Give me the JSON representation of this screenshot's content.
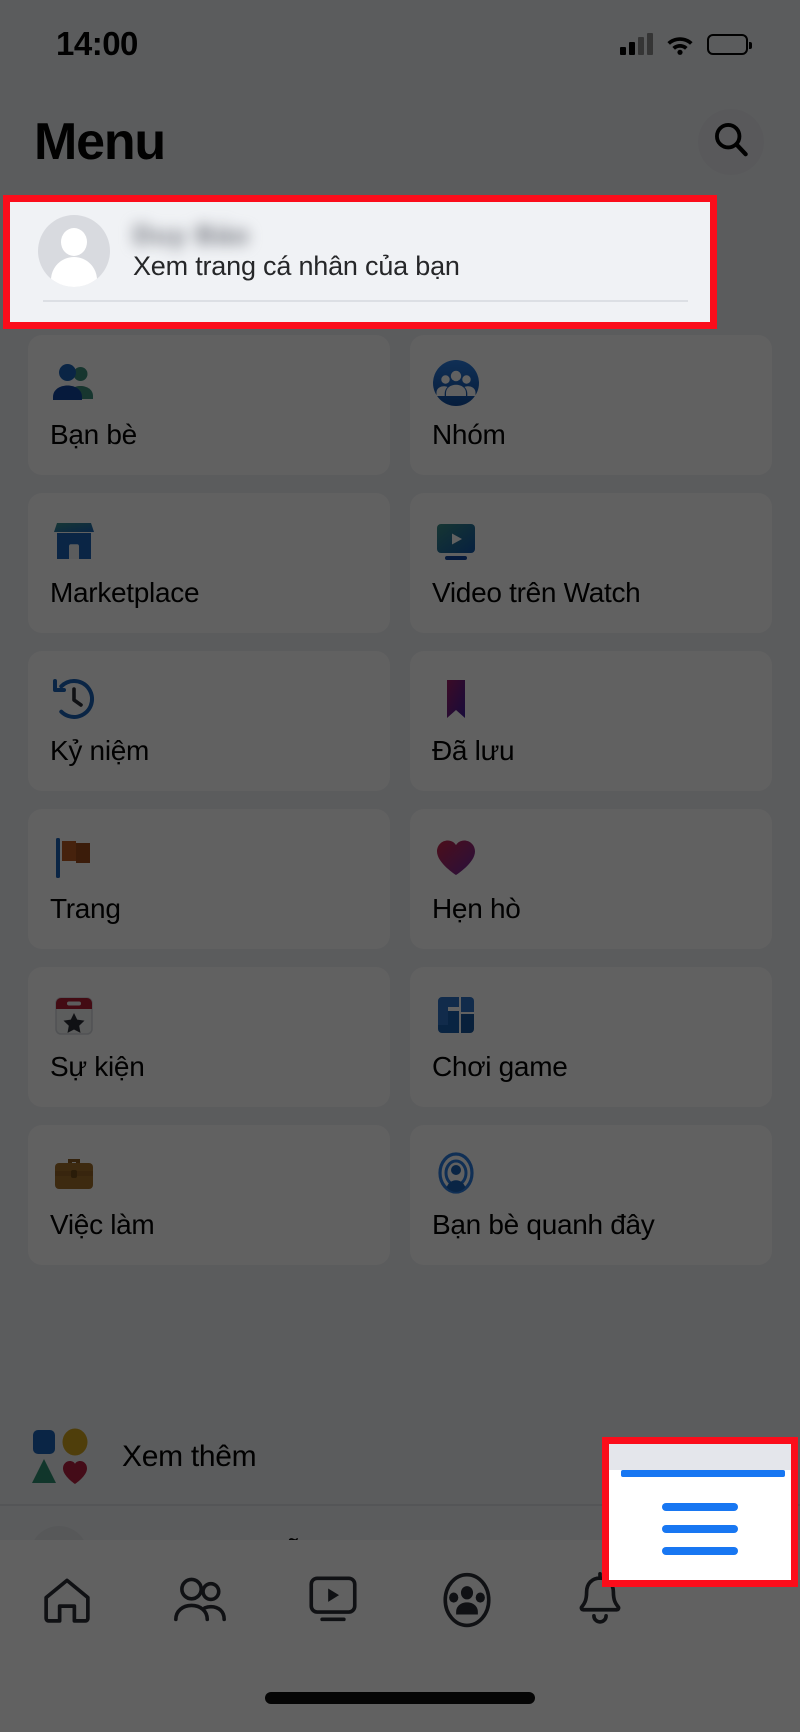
{
  "status_bar": {
    "time": "14:00",
    "signal_icon": "cellular-signal-icon",
    "wifi_icon": "wifi-icon",
    "battery_icon": "battery-icon",
    "battery_level": 60
  },
  "header": {
    "title": "Menu",
    "search_icon": "search-icon"
  },
  "profile": {
    "avatar_icon": "default-avatar-icon",
    "name": "Duy Bảo",
    "subtitle": "Xem trang cá nhân của bạn",
    "highlighted": true,
    "highlight_color": "#fb0d1b"
  },
  "grid": {
    "tiles": [
      {
        "label": "Bạn bè",
        "icon": "friends-icon"
      },
      {
        "label": "Nhóm",
        "icon": "groups-icon"
      },
      {
        "label": "Marketplace",
        "icon": "marketplace-icon"
      },
      {
        "label": "Video trên Watch",
        "icon": "watch-video-icon"
      },
      {
        "label": "Kỷ niệm",
        "icon": "memories-clock-icon"
      },
      {
        "label": "Đã lưu",
        "icon": "saved-bookmark-icon"
      },
      {
        "label": "Trang",
        "icon": "pages-flag-icon"
      },
      {
        "label": "Hẹn hò",
        "icon": "dating-heart-icon"
      },
      {
        "label": "Sự kiện",
        "icon": "events-calendar-icon"
      },
      {
        "label": "Chơi game",
        "icon": "gaming-icon"
      },
      {
        "label": "Việc làm",
        "icon": "jobs-briefcase-icon"
      },
      {
        "label": "Bạn bè quanh đây",
        "icon": "nearby-friends-icon"
      }
    ]
  },
  "see_more": {
    "label": "Xem thêm",
    "icon": "shapes-icon",
    "chevron_icon": "chevron-down-icon"
  },
  "hidden_row": {
    "label": "Trợ giúp & hỗ trợ"
  },
  "bottom_nav": {
    "items": [
      {
        "name": "home",
        "icon": "home-icon",
        "active": false
      },
      {
        "name": "friends",
        "icon": "friends-outline-icon",
        "active": false
      },
      {
        "name": "watch",
        "icon": "watch-outline-icon",
        "active": false
      },
      {
        "name": "groups",
        "icon": "groups-outline-icon",
        "active": false
      },
      {
        "name": "notifications",
        "icon": "bell-icon",
        "active": false
      },
      {
        "name": "menu",
        "icon": "hamburger-menu-icon",
        "active": true
      }
    ],
    "active_color": "#1877f2",
    "highlighted_item": "menu",
    "highlight_color": "#fb0d1b"
  }
}
